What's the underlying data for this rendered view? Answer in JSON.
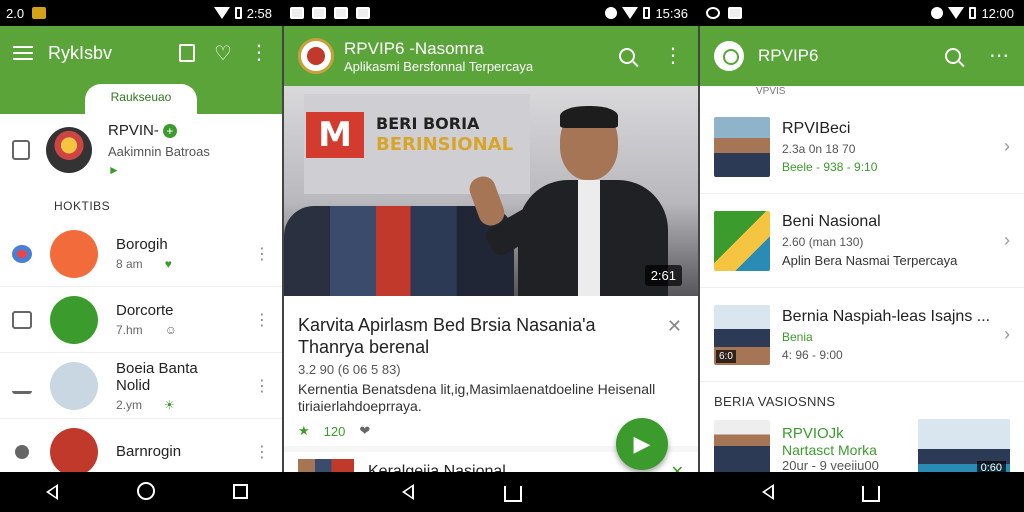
{
  "status_bars": [
    {
      "left_text": "2.0",
      "time": "2:58"
    },
    {
      "time": "15:36"
    },
    {
      "time": "12:00"
    }
  ],
  "panel1": {
    "app_title": "RykIsbv",
    "tab_label": "Raukseuao",
    "profile": {
      "name": "RPVIN-",
      "subtitle": "Aakimnin Batroas",
      "flag": "►"
    },
    "section_header": "HOKTIBS",
    "items": [
      {
        "title": "Borogih",
        "meta": "8 am",
        "meta2": "♥",
        "color": "#f26b3a"
      },
      {
        "title": "Dorcorte",
        "meta": "7.hm",
        "meta2": "☺",
        "color": "#3c9b2d"
      },
      {
        "title": "Boeia Banta Nolid",
        "meta": "2.ym",
        "meta2": "☀",
        "color": "#c9d7e3"
      },
      {
        "title": "Barnrogin",
        "meta": "",
        "meta2": "",
        "color": "#c0392b"
      }
    ]
  },
  "panel2": {
    "title": "RPVIP6 -Nasomra",
    "subtitle": "Aplikasmi Bersfonnal Terpercaya",
    "hero": {
      "banner_line1": "BERI BORIA",
      "banner_line2": "BERINSIONAL",
      "logo_letter": "M",
      "badge": "2:61"
    },
    "card": {
      "title": "Karvita Apirlasm Bed Brsia Nasania'a Thanrya berenal",
      "meta": "3.2 90 (6 06 5 83)",
      "description": "Kernentia Benatsdena lit,ig,Masimlaenatdoeline Heisenall tiriaierlahdoeprraya.",
      "rating": "120"
    },
    "card2_title": "Keralgeija Nasional"
  },
  "panel3": {
    "title": "RPVIP6",
    "stub_text": "VPVIS",
    "rows": [
      {
        "title": "RPVIBeci",
        "meta": "2.3a 0n 18 70",
        "meta2": "Beele - 938 - 9:10",
        "thumb": "person"
      },
      {
        "title": "Beni Nasional",
        "meta": "2.60 (man 130)",
        "sub": "Aplin Bera Nasmai Terpercaya",
        "thumb": "logo"
      },
      {
        "title": "Bernia Naspiah-leas Isajns ...",
        "meta_green": "Benia",
        "meta": "4: 96 - 9:00",
        "thumb": "people",
        "thumb_badge": "6:0"
      }
    ],
    "section_header": "BERIA VASIOSNNS",
    "bottom_row": {
      "title": "RPVIOJk",
      "sub": "Nartasct Morka",
      "meta": "20ur - 9 veeiiu00",
      "badge": "0:60"
    }
  }
}
